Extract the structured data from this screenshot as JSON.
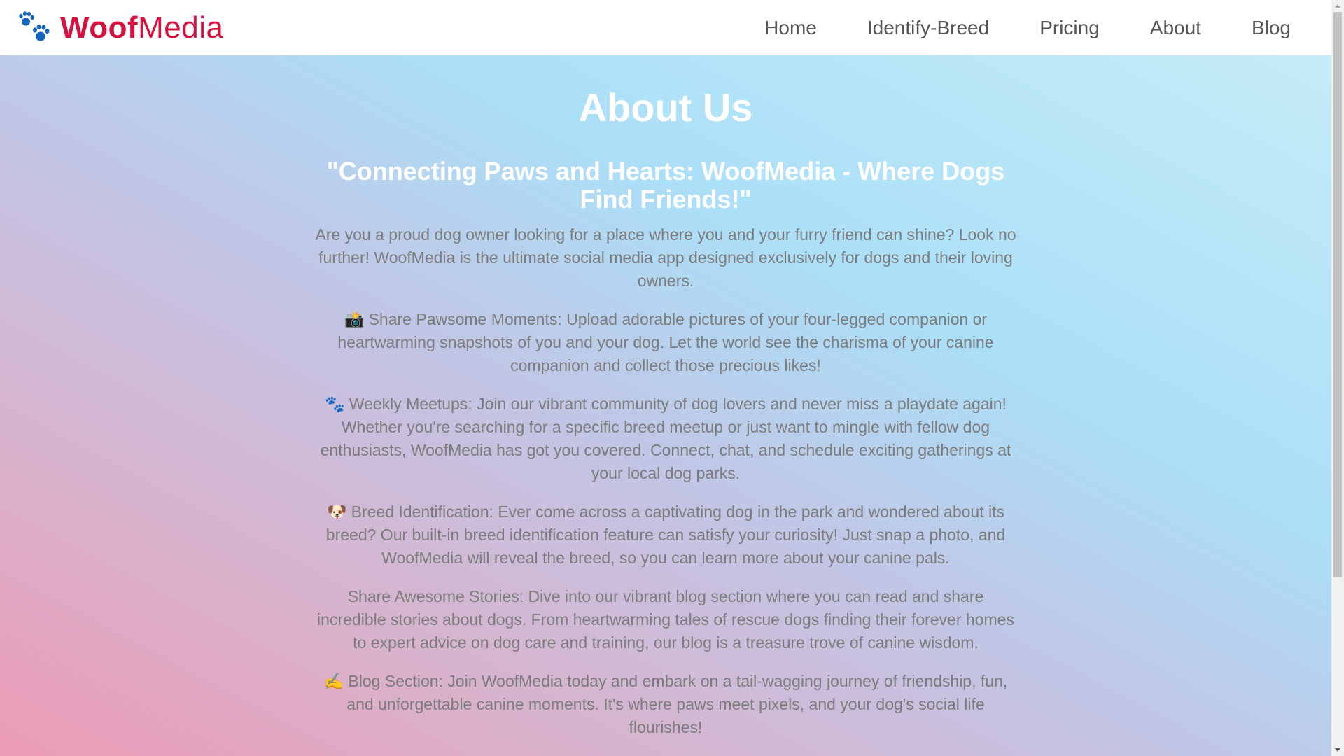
{
  "brand": {
    "name_bold": "Woof",
    "name_light": "Media",
    "icon": "paw-icon",
    "color": "#d5123f"
  },
  "nav": {
    "items": [
      {
        "label": "Home"
      },
      {
        "label": "Identify-Breed"
      },
      {
        "label": "Pricing"
      },
      {
        "label": "About"
      },
      {
        "label": "Blog"
      }
    ]
  },
  "main": {
    "title": "About Us",
    "tagline": "\"Connecting Paws and Hearts: WoofMedia - Where Dogs Find Friends!\"",
    "paragraphs": [
      {
        "emoji": "",
        "text": "Are you a proud dog owner looking for a place where you and your furry friend can shine? Look no further! WoofMedia is the ultimate social media app designed exclusively for dogs and their loving owners."
      },
      {
        "emoji": "📸",
        "text": "Share Pawsome Moments: Upload adorable pictures of your four-legged companion or heartwarming snapshots of you and your dog. Let the world see the charisma of your canine companion and collect those precious likes!"
      },
      {
        "emoji": "🐾",
        "text": "Weekly Meetups: Join our vibrant community of dog lovers and never miss a playdate again! Whether you're searching for a specific breed meetup or just want to mingle with fellow dog enthusiasts, WoofMedia has got you covered. Connect, chat, and schedule exciting gatherings at your local dog parks."
      },
      {
        "emoji": "🐶",
        "text": "Breed Identification: Ever come across a captivating dog in the park and wondered about its breed? Our built-in breed identification feature can satisfy your curiosity! Just snap a photo, and WoofMedia will reveal the breed, so you can learn more about your canine pals."
      },
      {
        "emoji": "",
        "text": "Share Awesome Stories: Dive into our vibrant blog section where you can read and share incredible stories about dogs. From heartwarming tales of rescue dogs finding their forever homes to expert advice on dog care and training, our blog is a treasure trove of canine wisdom."
      },
      {
        "emoji": "✍️",
        "text": "Blog Section: Join WoofMedia today and embark on a tail-wagging journey of friendship, fun, and unforgettable canine moments. It's where paws meet pixels, and your dog's social life flourishes!"
      }
    ]
  }
}
